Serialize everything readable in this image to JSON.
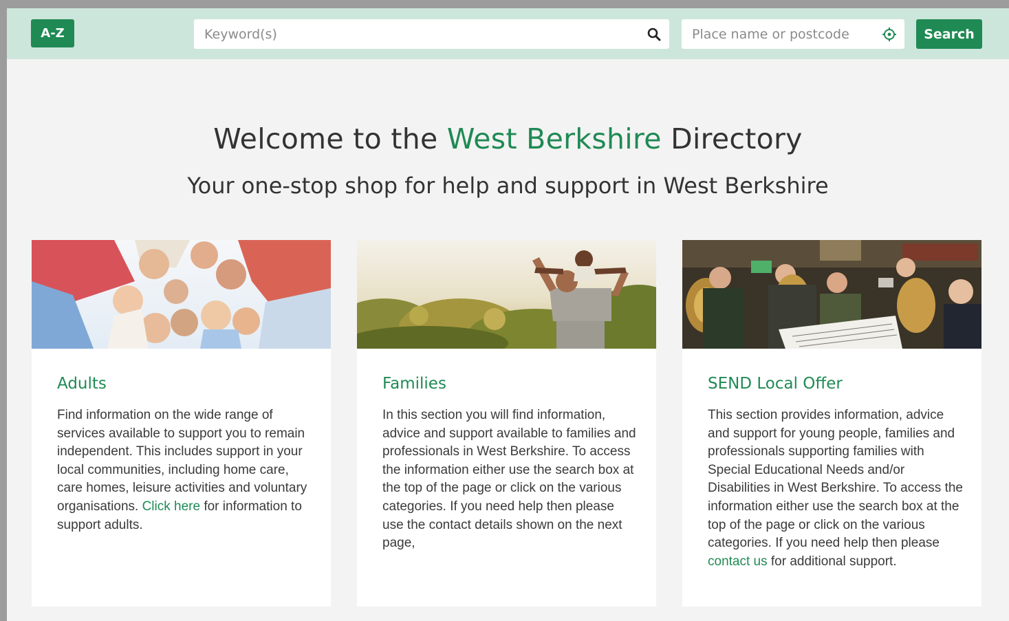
{
  "topbar": {
    "az_label": "A-Z",
    "keyword_placeholder": "Keyword(s)",
    "postcode_placeholder": "Place name or postcode",
    "search_label": "Search"
  },
  "hero": {
    "title_prefix": "Welcome to the ",
    "title_accent": "West Berkshire",
    "title_suffix": " Directory",
    "subtitle": "Your one-stop shop for help and support in West Berkshire"
  },
  "cards": [
    {
      "title": "Adults",
      "text_before": "Find information on the wide range of services available to support you to remain independent.  This includes support in your local communities, including home care, care homes, leisure activities and voluntary organisations. ",
      "link": "Click here",
      "text_after": " for information to support adults."
    },
    {
      "title": "Families",
      "text": "In this section you will find information, advice and support available to families and professionals in West Berkshire. To access the information either use the search box at the top of the page or click on the various categories. If you need help then please use the contact details shown on the next page,"
    },
    {
      "title": "SEND Local Offer",
      "text_before": "This section provides information, advice and support for young people, families and professionals supporting families with Special Educational Needs and/or Disabilities in West Berkshire. To access the information either use the search box at the top of the page or click on the various categories. If you need help then please ",
      "link": "contact us",
      "text_after": " for additional support."
    }
  ],
  "colors": {
    "brand_green": "#1f8a54",
    "topbar_bg": "#cde6dc",
    "page_bg": "#f3f3f3"
  },
  "icons": {
    "keyword_search": "search-icon",
    "postcode_locate": "crosshair-location-icon"
  }
}
